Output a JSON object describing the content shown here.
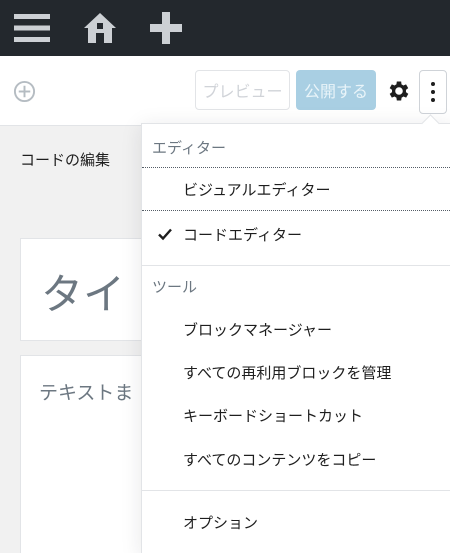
{
  "admin_bar": {
    "icons": [
      "menu-icon",
      "home-icon",
      "plus-icon"
    ]
  },
  "header": {
    "preview_label": "プレビュー",
    "publish_label": "公開する",
    "icons": [
      "add-block-icon",
      "gear-icon",
      "more-vertical-icon"
    ]
  },
  "editor": {
    "mode_label": "コードの編集",
    "title_placeholder": "タイ",
    "text_placeholder": "テキストま"
  },
  "dropdown": {
    "editor_group": {
      "label": "エディター",
      "items": [
        {
          "label": "ビジュアルエディター",
          "checked": false
        },
        {
          "label": "コードエディター",
          "checked": true
        }
      ]
    },
    "tools_group": {
      "label": "ツール",
      "items": [
        {
          "label": "ブロックマネージャー"
        },
        {
          "label": "すべての再利用ブロックを管理"
        },
        {
          "label": "キーボードショートカット"
        },
        {
          "label": "すべてのコンテンツをコピー"
        }
      ]
    },
    "options_label": "オプション"
  },
  "colors": {
    "admin_bar": "#23282d",
    "publish_disabled": "#a9cfe3",
    "muted_text": "#6c7781"
  }
}
